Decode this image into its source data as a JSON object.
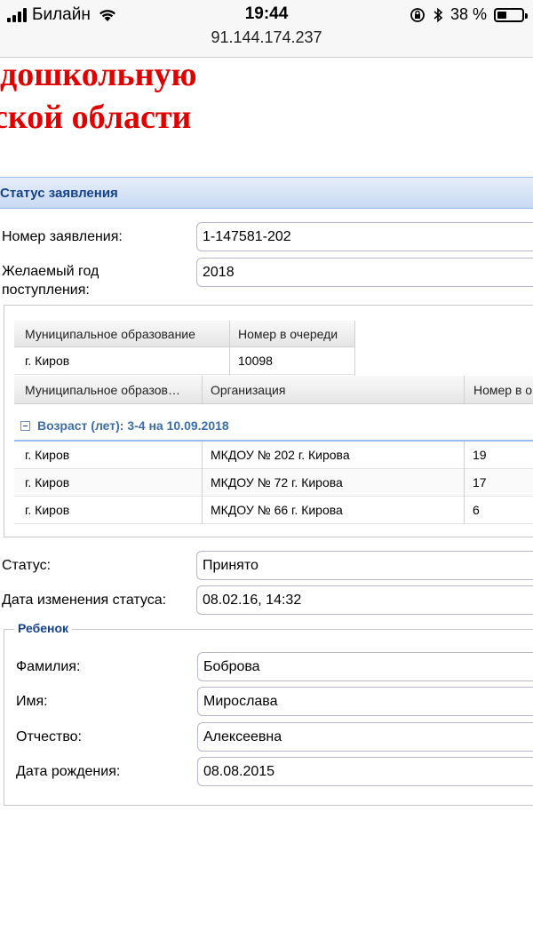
{
  "statusbar": {
    "carrier": "Билайн",
    "time": "19:44",
    "url": "91.144.174.237",
    "battery_text": "38 %",
    "battery_level": 0.38
  },
  "header": {
    "line1": "дошкольную",
    "line2": "ской области"
  },
  "panel": {
    "title": "Статус заявления"
  },
  "form": {
    "app_number_label": "Номер заявления:",
    "app_number_value": "1-147581-202",
    "year_label_1": "Желаемый год",
    "year_label_2": "поступления:",
    "year_value": "2018",
    "status_label": "Статус:",
    "status_value": "Принято",
    "status_date_label": "Дата изменения статуса:",
    "status_date_value": "08.02.16, 14:32"
  },
  "queue_grid": {
    "headers": [
      "Муниципальное образование",
      "Номер в очереди"
    ],
    "row": [
      "г. Киров",
      "10098"
    ]
  },
  "orgs_grid": {
    "headers": [
      "Муниципальное образов…",
      "Организация",
      "Номер в о"
    ],
    "group": "Возраст (лет): 3-4 на 10.09.2018",
    "rows": [
      [
        "г. Киров",
        "МКДОУ № 202 г. Кирова",
        "19"
      ],
      [
        "г. Киров",
        "МКДОУ № 72 г. Кирова",
        "17"
      ],
      [
        "г. Киров",
        "МКДОУ № 66 г. Кирова",
        "6"
      ]
    ]
  },
  "child": {
    "legend": "Ребенок",
    "last_name_label": "Фамилия:",
    "last_name_value": "Боброва",
    "first_name_label": "Имя:",
    "first_name_value": "Мирослава",
    "patronymic_label": "Отчество:",
    "patronymic_value": "Алексеевна",
    "birth_label": "Дата рождения:",
    "birth_value": "08.08.2015"
  },
  "icons": {
    "signal": "signal-icon",
    "wifi": "wifi-icon",
    "lock_rotation": "lock-rotation-icon",
    "bluetooth": "bluetooth-icon",
    "battery": "battery-icon",
    "collapse": "collapse-icon"
  },
  "colors": {
    "header_red": "#e00000",
    "panel_title": "#15428b",
    "group_text": "#3d6ea8"
  }
}
